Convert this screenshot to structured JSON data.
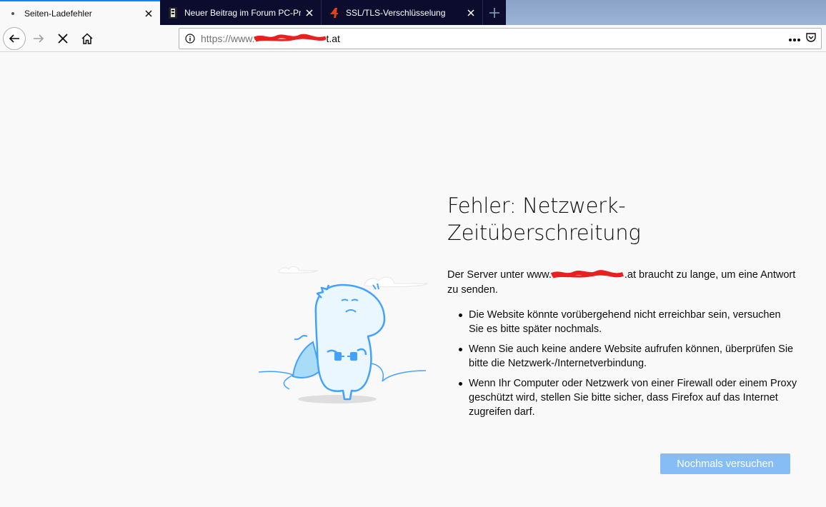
{
  "tabs": [
    {
      "label": "Seiten-Ladefehler",
      "active": true
    },
    {
      "label": "Neuer Beitrag im Forum PC-Pr",
      "active": false
    },
    {
      "label": "SSL/TLS-Verschlüsselung",
      "active": false
    }
  ],
  "navbar": {
    "url_prefix": "https://www.",
    "url_suffix": "t.at"
  },
  "error": {
    "title_line1": "Fehler: Netzwerk-",
    "title_line2": "Zeitüberschreitung",
    "desc_before": "Der Server unter www.",
    "desc_after": ".at braucht zu lange, um eine Antwort zu senden.",
    "bullets": [
      "Die Website könnte vorübergehend nicht erreichbar sein, versuchen Sie es bitte später nochmals.",
      "Wenn Sie auch keine andere Website aufrufen können, überprüfen Sie bitte die Netzwerk-/Internetverbindung.",
      "Wenn Ihr Computer oder Netzwerk von einer Firewall oder einem Proxy geschützt wird, stellen Sie bitte sicher, dass Firefox auf das Internet zugreifen darf."
    ],
    "retry_label": "Nochmals versuchen"
  },
  "colors": {
    "accent": "#0a84ff",
    "retry_button": "#87bdf5",
    "tabstrip": "#0c0c2e",
    "redaction": "#e8201f"
  }
}
